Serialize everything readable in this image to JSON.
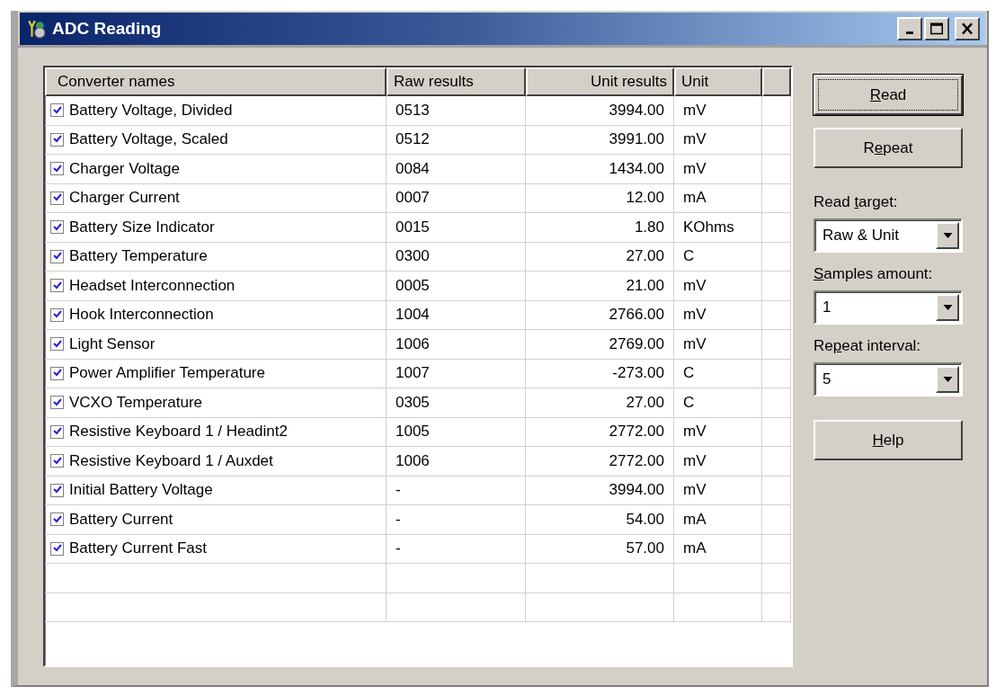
{
  "window": {
    "title": "ADC Reading"
  },
  "table": {
    "columns": [
      "Converter names",
      "Raw results",
      "Unit results",
      "Unit"
    ],
    "rows": [
      {
        "checked": true,
        "name": "Battery Voltage, Divided",
        "raw": "0513",
        "unit_result": "3994.00",
        "unit": "mV"
      },
      {
        "checked": true,
        "name": "Battery Voltage, Scaled",
        "raw": "0512",
        "unit_result": "3991.00",
        "unit": "mV"
      },
      {
        "checked": true,
        "name": "Charger Voltage",
        "raw": "0084",
        "unit_result": "1434.00",
        "unit": "mV"
      },
      {
        "checked": true,
        "name": "Charger Current",
        "raw": "0007",
        "unit_result": "12.00",
        "unit": "mA"
      },
      {
        "checked": true,
        "name": "Battery Size Indicator",
        "raw": "0015",
        "unit_result": "1.80",
        "unit": "KOhms"
      },
      {
        "checked": true,
        "name": "Battery Temperature",
        "raw": "0300",
        "unit_result": "27.00",
        "unit": "C"
      },
      {
        "checked": true,
        "name": "Headset Interconnection",
        "raw": "0005",
        "unit_result": "21.00",
        "unit": "mV"
      },
      {
        "checked": true,
        "name": "Hook Interconnection",
        "raw": "1004",
        "unit_result": "2766.00",
        "unit": "mV"
      },
      {
        "checked": true,
        "name": "Light Sensor",
        "raw": "1006",
        "unit_result": "2769.00",
        "unit": "mV"
      },
      {
        "checked": true,
        "name": "Power Amplifier Temperature",
        "raw": "1007",
        "unit_result": "-273.00",
        "unit": "C"
      },
      {
        "checked": true,
        "name": "VCXO Temperature",
        "raw": "0305",
        "unit_result": "27.00",
        "unit": "C"
      },
      {
        "checked": true,
        "name": "Resistive Keyboard 1 / Headint2",
        "raw": "1005",
        "unit_result": "2772.00",
        "unit": "mV"
      },
      {
        "checked": true,
        "name": "Resistive Keyboard 1 / Auxdet",
        "raw": "1006",
        "unit_result": "2772.00",
        "unit": "mV"
      },
      {
        "checked": true,
        "name": "Initial Battery Voltage",
        "raw": "-",
        "unit_result": "3994.00",
        "unit": "mV"
      },
      {
        "checked": true,
        "name": "Battery Current",
        "raw": "-",
        "unit_result": "54.00",
        "unit": "mA"
      },
      {
        "checked": true,
        "name": "Battery Current Fast",
        "raw": "-",
        "unit_result": "57.00",
        "unit": "mA"
      }
    ]
  },
  "controls": [
    {
      "kind": "button",
      "access_key": "R",
      "label_after": "ead",
      "focused": true
    },
    {
      "kind": "button",
      "label_before": "R",
      "access_key": "e",
      "label_after": "peat",
      "focused": false
    },
    {
      "kind": "label",
      "label_before": "Read ",
      "access_key": "t",
      "label_after": "arget:"
    },
    {
      "kind": "combo",
      "value": "Raw & Unit"
    },
    {
      "kind": "label",
      "access_key": "S",
      "label_after": "amples amount:"
    },
    {
      "kind": "combo",
      "value": "1"
    },
    {
      "kind": "label",
      "label_before": "Re",
      "access_key": "p",
      "label_after": "eat interval:"
    },
    {
      "kind": "combo",
      "value": "5"
    },
    {
      "kind": "button",
      "access_key": "H",
      "label_after": "elp",
      "focused": false
    }
  ]
}
